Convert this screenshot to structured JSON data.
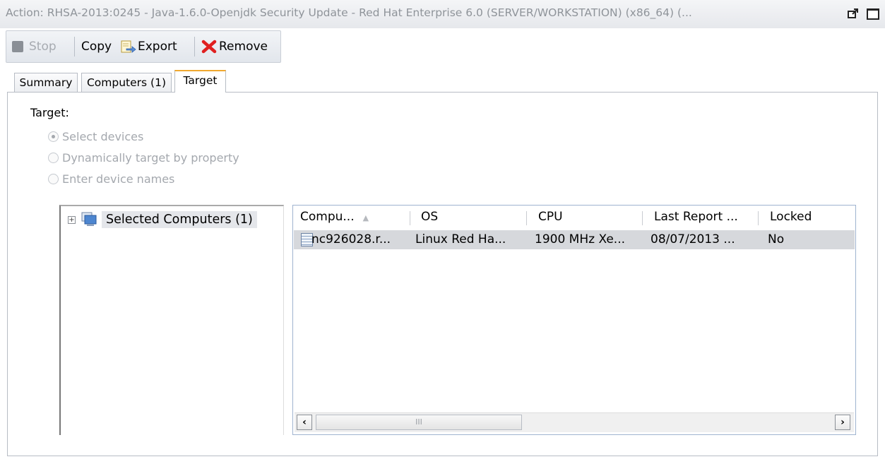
{
  "window": {
    "title": "Action: RHSA-2013:0245 - Java-1.6.0-Openjdk Security Update - Red Hat Enterprise 6.0 (SERVER/WORKSTATION) (x86_64) (..."
  },
  "toolbar": {
    "stop_label": "Stop",
    "copy_label": "Copy",
    "export_label": "Export",
    "remove_label": "Remove"
  },
  "tabs": [
    {
      "label": "Summary",
      "active": false
    },
    {
      "label": "Computers (1)",
      "active": false
    },
    {
      "label": "Target",
      "active": true
    }
  ],
  "target": {
    "label": "Target:",
    "options": [
      {
        "label": "Select devices",
        "selected": true
      },
      {
        "label": "Dynamically target by property",
        "selected": false
      },
      {
        "label": "Enter device names",
        "selected": false
      }
    ]
  },
  "tree": {
    "root_label": "Selected Computers (1)",
    "expander": "+"
  },
  "table": {
    "columns": [
      "Compu...",
      "OS",
      "CPU",
      "Last Report ...",
      "Locked"
    ],
    "sort_column": "Compu...",
    "rows": [
      [
        "nc926028.r...",
        "Linux Red Ha...",
        "1900 MHz Xe...",
        "08/07/2013 ...",
        "No"
      ]
    ],
    "scroll_thumb_grip": "III"
  },
  "colors": {
    "remove_x": "#e02020",
    "tab_active_accent": "#f0a830",
    "selection": "#d6d8dc"
  },
  "icons": [
    "stop-icon",
    "export-icon",
    "remove-icon",
    "computers-group-icon",
    "server-icon",
    "detach-icon",
    "maximize-icon"
  ]
}
